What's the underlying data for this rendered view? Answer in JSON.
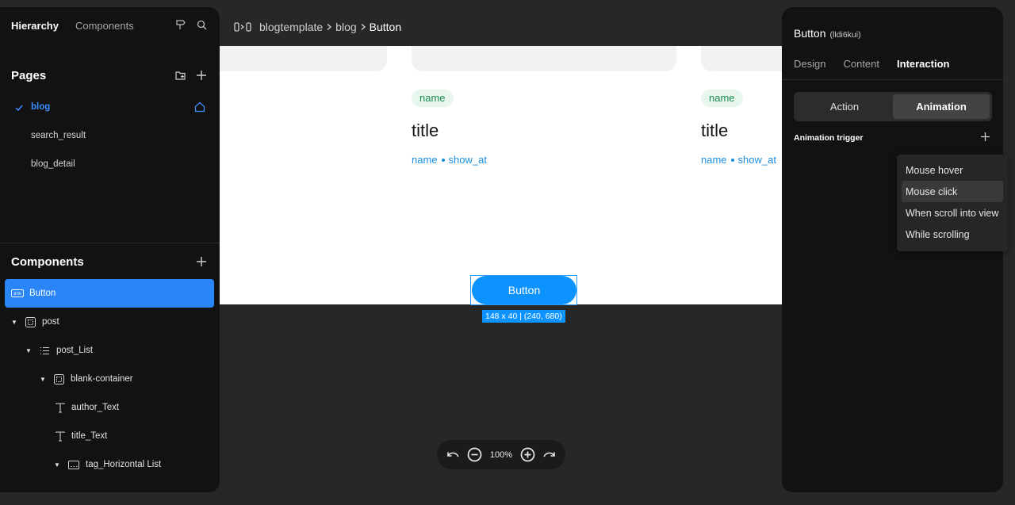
{
  "left_panel": {
    "tabs": [
      "Hierarchy",
      "Components"
    ],
    "pages_title": "Pages",
    "pages": [
      {
        "label": "blog",
        "active": true
      },
      {
        "label": "search_result",
        "active": false
      },
      {
        "label": "blog_detail",
        "active": false
      }
    ],
    "components_title": "Components",
    "components": [
      {
        "label": "Button",
        "badge": "BTN"
      },
      {
        "label": "post"
      },
      {
        "label": "post_List"
      },
      {
        "label": "blank-container"
      },
      {
        "label": "author_Text"
      },
      {
        "label": "title_Text"
      },
      {
        "label": "tag_Horizontal List"
      }
    ]
  },
  "breadcrumb": {
    "items": [
      "blogtemplate",
      "blog",
      "Button"
    ]
  },
  "canvas": {
    "cards": [
      {
        "tag": "name",
        "title": "title",
        "author": "name",
        "date": "show_at"
      },
      {
        "tag": "name",
        "title": "title",
        "author": "name",
        "date": "show_at"
      }
    ],
    "button_label": "Button",
    "size_label": "148 x 40 | (240, 680)"
  },
  "zoom": {
    "value": "100%"
  },
  "right_panel": {
    "title": "Button",
    "id": "(lldi6kui)",
    "tabs": [
      "Design",
      "Content",
      "Interaction"
    ],
    "segments": [
      "Action",
      "Animation"
    ],
    "trigger_label": "Animation trigger",
    "dropdown": [
      "Mouse hover",
      "Mouse click",
      "When scroll into view",
      "While scrolling"
    ]
  },
  "colors": {
    "accent": "#2a86f6",
    "canvas_button": "#0d93ff",
    "tag_bg": "#e8f7ee",
    "tag_text": "#1b8a52",
    "meta_text": "#1a8fe0"
  }
}
